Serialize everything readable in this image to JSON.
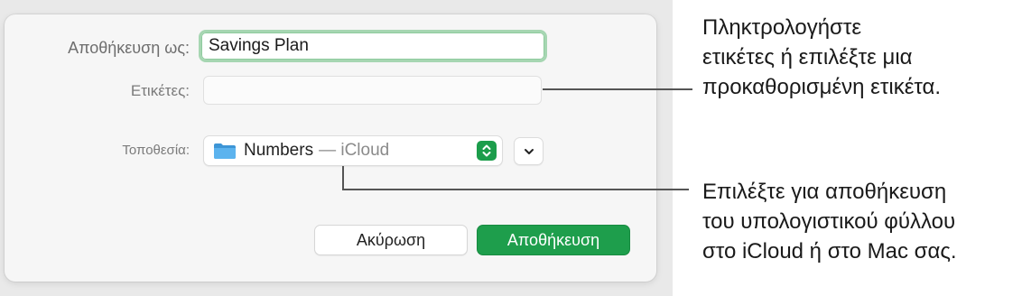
{
  "dialog": {
    "save_as_label": "Αποθήκευση ως:",
    "save_as_value": "Savings Plan",
    "tags_label": "Ετικέτες:",
    "tags_value": "",
    "location_label": "Τοποθεσία:",
    "location_folder": "Numbers",
    "location_sub": "— iCloud",
    "cancel_label": "Ακύρωση",
    "save_label": "Αποθήκευση"
  },
  "callouts": {
    "tags": [
      "Πληκτρολογήστε",
      "ετικέτες ή επιλέξτε μια",
      "προκαθορισμένη ετικέτα."
    ],
    "location": [
      "Επιλέξτε για αποθήκευση",
      "του υπολογιστικού φύλλου",
      "στο iCloud ή στο Mac σας."
    ]
  },
  "colors": {
    "accent_green": "#1e9e4c",
    "focus_ring": "#a6d6b2",
    "folder_blue": "#4fa8e6"
  },
  "icons": {
    "location_folder": "folder-icon",
    "location_stepper": "chevron-updown-icon",
    "expand": "chevron-down-icon"
  }
}
